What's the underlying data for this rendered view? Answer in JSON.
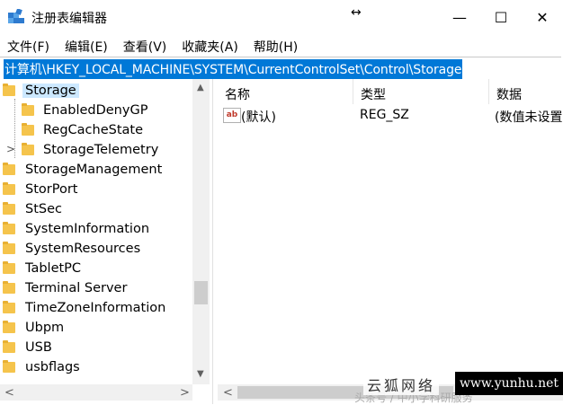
{
  "window": {
    "title": "注册表编辑器",
    "resize_cursor_glyph": "↔",
    "minimize_glyph": "—",
    "maximize_glyph": "☐",
    "close_glyph": "✕",
    "app_icon": "regedit-icon"
  },
  "menubar": {
    "items": [
      {
        "label": "文件(F)"
      },
      {
        "label": "编辑(E)"
      },
      {
        "label": "查看(V)"
      },
      {
        "label": "收藏夹(A)"
      },
      {
        "label": "帮助(H)"
      }
    ]
  },
  "address": {
    "path": "计算机\\HKEY_LOCAL_MACHINE\\SYSTEM\\CurrentControlSet\\Control\\Storage"
  },
  "tree": {
    "items": [
      {
        "label": "Storage",
        "selected": true,
        "expanded": true,
        "level": 0
      },
      {
        "label": "EnabledDenyGP",
        "level": 1
      },
      {
        "label": "RegCacheState",
        "level": 1
      },
      {
        "label": "StorageTelemetry",
        "level": 1,
        "has_children": true
      },
      {
        "label": "StorageManagement",
        "level": 0
      },
      {
        "label": "StorPort",
        "level": 0
      },
      {
        "label": "StSec",
        "level": 0
      },
      {
        "label": "SystemInformation",
        "level": 0
      },
      {
        "label": "SystemResources",
        "level": 0
      },
      {
        "label": "TabletPC",
        "level": 0
      },
      {
        "label": "Terminal Server",
        "level": 0
      },
      {
        "label": "TimeZoneInformation",
        "level": 0
      },
      {
        "label": "Ubpm",
        "level": 0
      },
      {
        "label": "USB",
        "level": 0
      },
      {
        "label": "usbflags",
        "level": 0
      }
    ],
    "expand_glyph": ">",
    "collapse_glyph": "∨"
  },
  "list": {
    "columns": [
      {
        "label": "名称"
      },
      {
        "label": "类型"
      },
      {
        "label": "数据"
      }
    ],
    "rows": [
      {
        "icon": "string-value-icon",
        "icon_text": "ab",
        "name": "(默认)",
        "type": "REG_SZ",
        "data": "(数值未设置)"
      }
    ]
  },
  "scroll": {
    "up": "▲",
    "down": "▼",
    "left": "<",
    "right": ">"
  },
  "watermark": {
    "left_text": "云狐网络",
    "right_text": "www.yunhu.net",
    "under_text": "头条号 / 中小学科研服务"
  }
}
